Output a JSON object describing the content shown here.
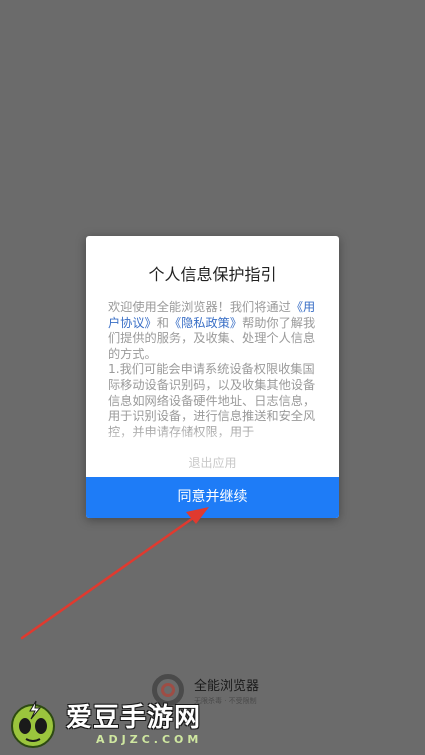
{
  "dialog": {
    "title": "个人信息保护指引",
    "intro_prefix": "欢迎使用全能浏览器！我们将通过",
    "user_agreement_link": "《用户协议》",
    "and": "和",
    "privacy_policy_link": "《隐私政策》",
    "intro_suffix": "帮助你了解我们提供的服务，及收集、处理个人信息的方式。",
    "item_1": "1.我们可能会申请系统设备权限收集国际移动设备识别码，以及收集其他设备信息如网络设备硬件地址、日志信息，用于识别设备，进行信息推送和安全风控，并申请存储权限，用于",
    "exit_label": "退出应用",
    "agree_label": "同意并继续"
  },
  "brand": {
    "name": "全能浏览器",
    "tagline": "无限杀毒 · 不受限制"
  },
  "watermark": {
    "site_name": "爱豆手游网",
    "domain": "ADJZC.COM"
  },
  "colors": {
    "overlay": "#6b6b6b",
    "accent": "#1e7cf7",
    "link": "#3a6fc6",
    "arrow": "#e03a2f"
  }
}
